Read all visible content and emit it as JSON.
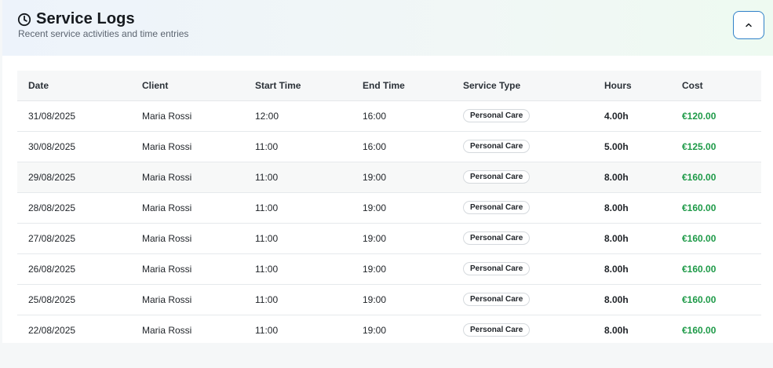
{
  "header": {
    "title": "Service Logs",
    "subtitle": "Recent service activities and time entries",
    "icon": "clock-icon",
    "collapse_icon": "chevron-up-icon",
    "accent_color": "#2f80c8"
  },
  "table": {
    "columns": [
      "Date",
      "Client",
      "Start Time",
      "End Time",
      "Service Type",
      "Hours",
      "Cost"
    ],
    "rows": [
      {
        "date": "31/08/2025",
        "client": "Maria Rossi",
        "start": "12:00",
        "end": "16:00",
        "type": "Personal Care",
        "hours": "4.00h",
        "cost": "€120.00"
      },
      {
        "date": "30/08/2025",
        "client": "Maria Rossi",
        "start": "11:00",
        "end": "16:00",
        "type": "Personal Care",
        "hours": "5.00h",
        "cost": "€125.00"
      },
      {
        "date": "29/08/2025",
        "client": "Maria Rossi",
        "start": "11:00",
        "end": "19:00",
        "type": "Personal Care",
        "hours": "8.00h",
        "cost": "€160.00"
      },
      {
        "date": "28/08/2025",
        "client": "Maria Rossi",
        "start": "11:00",
        "end": "19:00",
        "type": "Personal Care",
        "hours": "8.00h",
        "cost": "€160.00"
      },
      {
        "date": "27/08/2025",
        "client": "Maria Rossi",
        "start": "11:00",
        "end": "19:00",
        "type": "Personal Care",
        "hours": "8.00h",
        "cost": "€160.00"
      },
      {
        "date": "26/08/2025",
        "client": "Maria Rossi",
        "start": "11:00",
        "end": "19:00",
        "type": "Personal Care",
        "hours": "8.00h",
        "cost": "€160.00"
      },
      {
        "date": "25/08/2025",
        "client": "Maria Rossi",
        "start": "11:00",
        "end": "19:00",
        "type": "Personal Care",
        "hours": "8.00h",
        "cost": "€160.00"
      },
      {
        "date": "22/08/2025",
        "client": "Maria Rossi",
        "start": "11:00",
        "end": "19:00",
        "type": "Personal Care",
        "hours": "8.00h",
        "cost": "€160.00"
      }
    ],
    "cost_color": "#1e9a48"
  }
}
